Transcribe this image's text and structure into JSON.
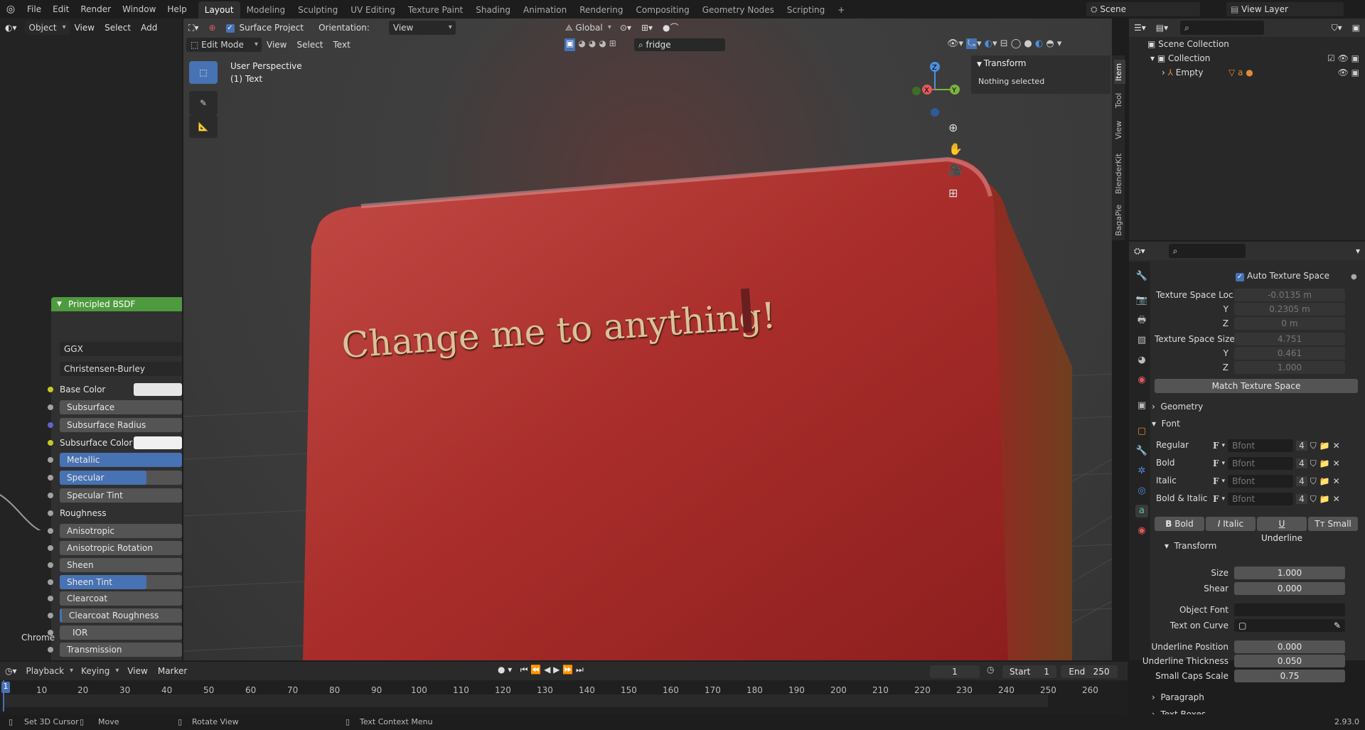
{
  "menu": {
    "file": "File",
    "edit": "Edit",
    "render": "Render",
    "window": "Window",
    "help": "Help"
  },
  "workspaces": [
    "Layout",
    "Modeling",
    "Sculpting",
    "UV Editing",
    "Texture Paint",
    "Shading",
    "Animation",
    "Rendering",
    "Compositing",
    "Geometry Nodes",
    "Scripting"
  ],
  "active_workspace": "Layout",
  "scene": {
    "name": "Scene",
    "view_layer": "View Layer"
  },
  "node_header": {
    "mode": "Object",
    "view": "View",
    "select": "Select",
    "add": "Add"
  },
  "viewport_header": {
    "surface_project": "Surface Project",
    "orientation_label": "Orientation:",
    "orientation_value": "View",
    "transform_orientation": "Global",
    "search_value": "fridge"
  },
  "viewport_sub": {
    "mode": "Edit Mode",
    "view": "View",
    "select": "Select",
    "text": "Text"
  },
  "viewport": {
    "perspective": "User Perspective",
    "object": "(1) Text",
    "scene_text": "Change me to anything!"
  },
  "npanel": {
    "title": "Transform",
    "nothing": "Nothing selected",
    "tabs": [
      "Item",
      "Tool",
      "View",
      "BlenderKit",
      "BagaPie"
    ]
  },
  "node": {
    "title": "Principled BSDF",
    "distribution": "GGX",
    "subsurface_method": "Christensen-Burley",
    "chrome_label": "Chrome",
    "inputs": [
      "Base Color",
      "Subsurface",
      "Subsurface Radius",
      "Subsurface Color",
      "Metallic",
      "Specular",
      "Specular Tint",
      "Roughness",
      "Anisotropic",
      "Anisotropic Rotation",
      "Sheen",
      "Sheen Tint",
      "Clearcoat",
      "Clearcoat Roughness",
      "IOR",
      "Transmission"
    ]
  },
  "outliner": {
    "scene_collection": "Scene Collection",
    "collection": "Collection",
    "empty": "Empty"
  },
  "properties": {
    "auto_texture_space": "Auto Texture Space",
    "texture_space_location": {
      "label": "Texture Space Loc...",
      "x": "-0.0135 m",
      "y": "0.2305 m",
      "z": "0 m"
    },
    "texture_space_size": {
      "label": "Texture Space Size",
      "x": "4.751",
      "y": "0.461",
      "z": "1.000"
    },
    "axis": {
      "y": "Y",
      "z": "Z"
    },
    "match_button": "Match Texture Space",
    "geometry": "Geometry",
    "font": "Font",
    "fonts": [
      {
        "label": "Regular",
        "name": "Bfont",
        "users": "4"
      },
      {
        "label": "Bold",
        "name": "Bfont",
        "users": "4"
      },
      {
        "label": "Italic",
        "name": "Bfont",
        "users": "4"
      },
      {
        "label": "Bold & Italic",
        "name": "Bfont",
        "users": "4"
      }
    ],
    "style_buttons": [
      "Bold",
      "Italic",
      "Underline",
      "Small C..."
    ],
    "transform": "Transform",
    "size": {
      "label": "Size",
      "value": "1.000"
    },
    "shear": {
      "label": "Shear",
      "value": "0.000"
    },
    "object_font": "Object Font",
    "text_on_curve": "Text on Curve",
    "underline_position": {
      "label": "Underline Position",
      "value": "0.000"
    },
    "underline_thickness": {
      "label": "Underline Thickness",
      "value": "0.050"
    },
    "small_caps_scale": {
      "label": "Small Caps Scale",
      "value": "0.75"
    },
    "paragraph": "Paragraph",
    "text_boxes": "Text Boxes"
  },
  "timeline": {
    "playback": "Playback",
    "keying": "Keying",
    "view": "View",
    "marker": "Marker",
    "current_frame": "1",
    "start_label": "Start",
    "start": "1",
    "end_label": "End",
    "end": "250",
    "ruler": [
      "1",
      "10",
      "20",
      "30",
      "40",
      "50",
      "60",
      "70",
      "80",
      "90",
      "100",
      "110",
      "120",
      "130",
      "140",
      "150",
      "160",
      "170",
      "180",
      "190",
      "200",
      "210",
      "220",
      "230",
      "240",
      "250",
      "260"
    ]
  },
  "status": {
    "set_cursor": "Set 3D Cursor",
    "move": "Move",
    "rotate": "Rotate View",
    "context": "Text Context Menu",
    "version": "2.93.0"
  }
}
